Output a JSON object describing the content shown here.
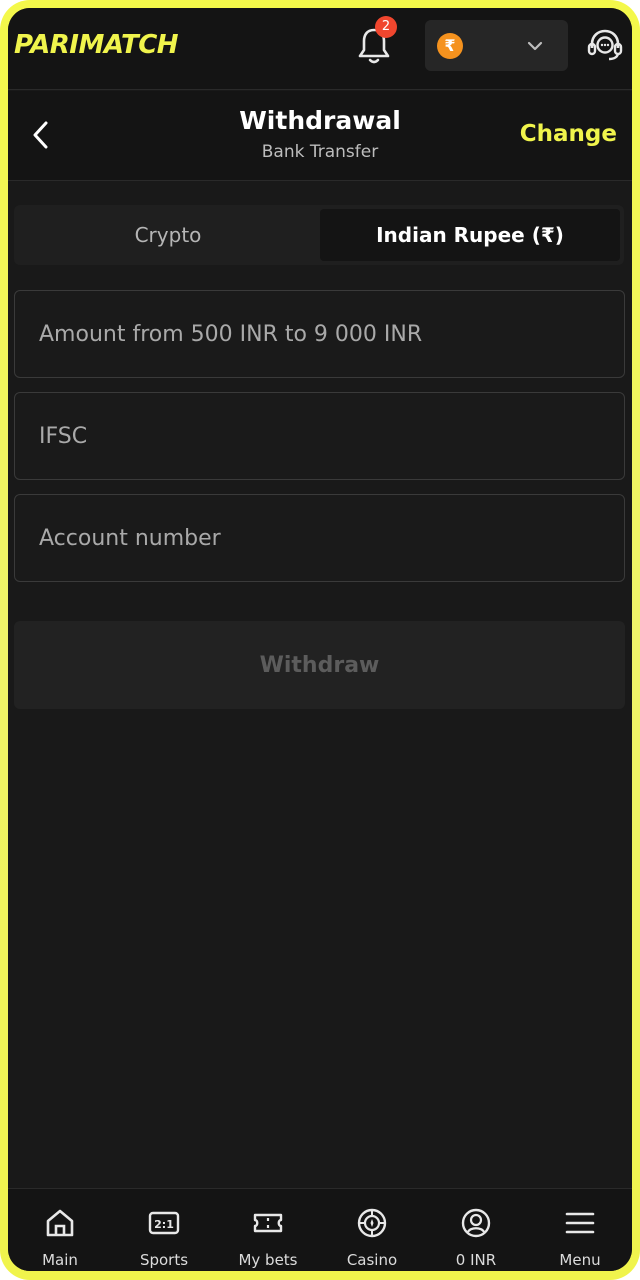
{
  "header": {
    "logo": "PARIMATCH",
    "notification_count": "2",
    "currency_symbol": "₹"
  },
  "subheader": {
    "title": "Withdrawal",
    "subtitle": "Bank Transfer",
    "change_label": "Change"
  },
  "tabs": [
    {
      "label": "Crypto",
      "active": false
    },
    {
      "label": "Indian Rupee (₹)",
      "active": true
    }
  ],
  "form": {
    "amount_placeholder": "Amount from 500 INR to 9 000 INR",
    "ifsc_placeholder": "IFSC",
    "account_placeholder": "Account number",
    "submit_label": "Withdraw"
  },
  "bottom_nav": [
    {
      "label": "Main",
      "icon": "home-icon"
    },
    {
      "label": "Sports",
      "icon": "scoreboard-icon"
    },
    {
      "label": "My bets",
      "icon": "ticket-icon"
    },
    {
      "label": "Casino",
      "icon": "casino-chip-icon"
    },
    {
      "label": "0 INR",
      "icon": "account-icon"
    },
    {
      "label": "Menu",
      "icon": "menu-icon"
    }
  ],
  "colors": {
    "accent": "#f0f44c",
    "background": "#191919",
    "badge": "#f0462e",
    "coin": "#f5921e"
  }
}
